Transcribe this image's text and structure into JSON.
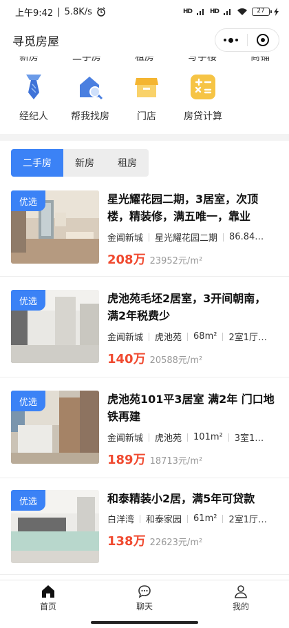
{
  "status_bar": {
    "time": "上午9:42",
    "speed": "5.8K/s",
    "signal1": "HD",
    "signal2": "HD",
    "battery": "27"
  },
  "header": {
    "title": "寻觅房屋"
  },
  "menu": {
    "hidden_row": [
      "新房",
      "二手房",
      "租房",
      "写字楼",
      "商铺"
    ],
    "items": [
      {
        "label": "经纪人",
        "icon": "tie-icon"
      },
      {
        "label": "帮我找房",
        "icon": "house-search-icon"
      },
      {
        "label": "门店",
        "icon": "store-icon"
      },
      {
        "label": "房贷计算",
        "icon": "calculator-icon"
      }
    ]
  },
  "tabs": [
    "二手房",
    "新房",
    "租房"
  ],
  "listings": [
    {
      "tag": "优选",
      "title": "星光耀花园二期，3居室，次顶楼，精装修，满五唯一，靠业",
      "meta": [
        "金阊新城",
        "星光耀花园二期",
        "86.84…"
      ],
      "price": "208万",
      "unit_price": "23952元/m²"
    },
    {
      "tag": "优选",
      "title": "虎池苑毛坯2居室，3开间朝南，满2年税费少",
      "meta": [
        "金阊新城",
        "虎池苑",
        "68m²",
        "2室1厅…"
      ],
      "price": "140万",
      "unit_price": "20588元/m²"
    },
    {
      "tag": "优选",
      "title": "虎池苑101平3居室 满2年 门口地铁再建",
      "meta": [
        "金阊新城",
        "虎池苑",
        "101m²",
        "3室1…"
      ],
      "price": "189万",
      "unit_price": "18713元/m²"
    },
    {
      "tag": "优选",
      "title": "和泰精装小2居，满5年可贷款",
      "meta": [
        "白洋湾",
        "和泰家园",
        "61m²",
        "2室1厅…"
      ],
      "price": "138万",
      "unit_price": "22623元/m²"
    }
  ],
  "bottom_nav": [
    {
      "label": "首页",
      "icon": "home-icon",
      "active": true
    },
    {
      "label": "聊天",
      "icon": "chat-icon",
      "active": false
    },
    {
      "label": "我的",
      "icon": "user-icon",
      "active": false
    }
  ],
  "colors": {
    "accent": "#3b82f6",
    "price": "#f04a30",
    "menu_icon_blue": "#4a7fe0",
    "menu_icon_yellow": "#f6c445"
  }
}
